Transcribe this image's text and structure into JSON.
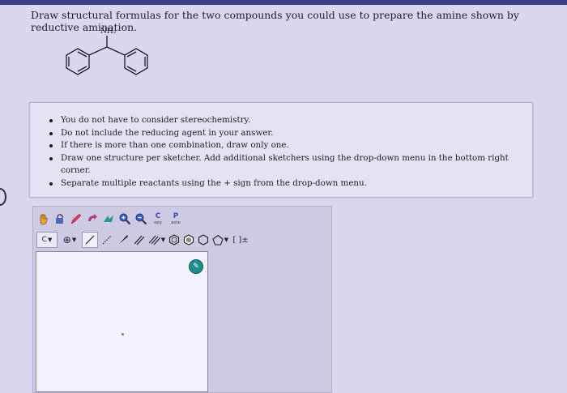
{
  "question": {
    "text": "Draw structural formulas for the two compounds you could use to prepare the amine shown by reductive amination."
  },
  "molecule": {
    "amine_label": "NH₂"
  },
  "instructions": {
    "items": [
      "You do not have to consider stereochemistry.",
      "Do not include the reducing agent in your answer.",
      "If there is more than one combination, draw only one.",
      "Draw one structure per sketcher. Add additional sketchers using the drop-down menu in the bottom right corner.",
      "Separate multiple reactants using the + sign from the drop-down menu."
    ]
  },
  "sketcher": {
    "copy_letter": "C",
    "copy_label": "opy",
    "paste_letter": "P",
    "paste_label": "aste",
    "atom_label": "C",
    "charge_symbol": "⊕",
    "bracket_label": "[ ]±",
    "badge_label": "✎"
  },
  "colors": {
    "accent": "#3a3f8c",
    "page_background": "#dcd6ee",
    "panel_background": "#e6e1f3",
    "badge": "#1c8f8a"
  }
}
